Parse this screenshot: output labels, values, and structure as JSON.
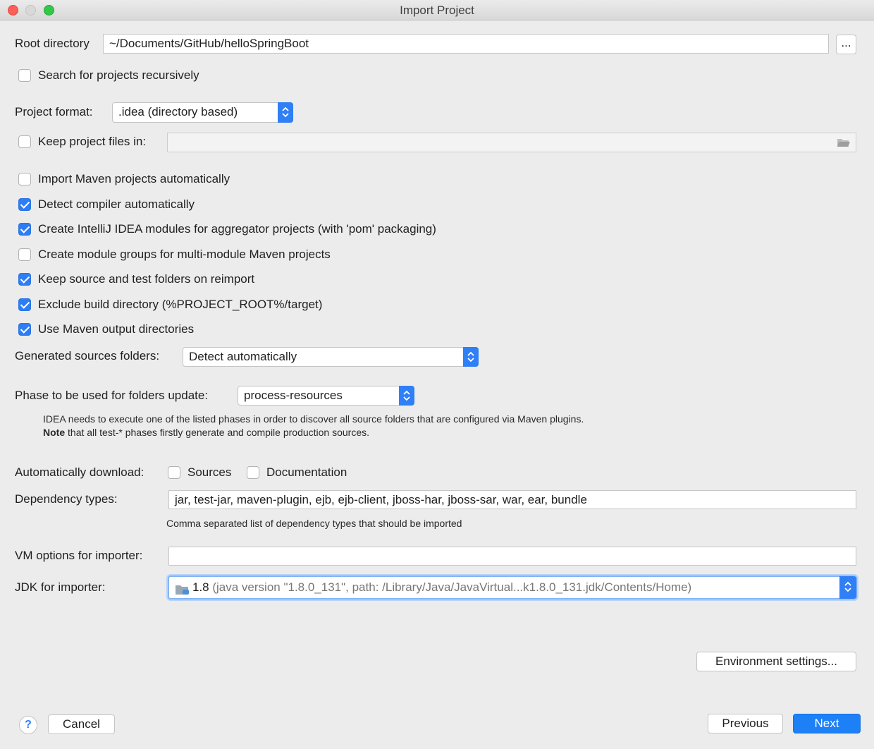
{
  "window": {
    "title": "Import Project"
  },
  "root_directory": {
    "label": "Root directory",
    "value": "~/Documents/GitHub/helloSpringBoot",
    "browse_label": "..."
  },
  "search_recursive": {
    "label": "Search for projects recursively",
    "checked": false
  },
  "project_format": {
    "label": "Project format:",
    "value": ".idea (directory based)"
  },
  "keep_files": {
    "label": "Keep project files in:",
    "value": "",
    "checked": false
  },
  "options": [
    {
      "label": "Import Maven projects automatically",
      "checked": false
    },
    {
      "label": "Detect compiler automatically",
      "checked": true
    },
    {
      "label": "Create IntelliJ IDEA modules for aggregator projects (with 'pom' packaging)",
      "checked": true
    },
    {
      "label": "Create module groups for multi-module Maven projects",
      "checked": false
    },
    {
      "label": "Keep source and test folders on reimport",
      "checked": true
    },
    {
      "label": "Exclude build directory (%PROJECT_ROOT%/target)",
      "checked": true
    },
    {
      "label": "Use Maven output directories",
      "checked": true
    }
  ],
  "generated_sources": {
    "label": "Generated sources folders:",
    "value": "Detect automatically"
  },
  "phase": {
    "label": "Phase to be used for folders update:",
    "value": "process-resources",
    "note_line1": "IDEA needs to execute one of the listed phases in order to discover all source folders that are configured via Maven plugins.",
    "note_bold": "Note",
    "note_line2": " that all test-* phases firstly generate and compile production sources."
  },
  "auto_download": {
    "label": "Automatically download:",
    "sources": {
      "label": "Sources",
      "checked": false
    },
    "documentation": {
      "label": "Documentation",
      "checked": false
    }
  },
  "dependency_types": {
    "label": "Dependency types:",
    "value": "jar, test-jar, maven-plugin, ejb, ejb-client, jboss-har, jboss-sar, war, ear, bundle",
    "hint": "Comma separated list of dependency types that should be imported"
  },
  "vm_options": {
    "label": "VM options for importer:",
    "value": ""
  },
  "jdk": {
    "label": "JDK for importer:",
    "version": "1.8",
    "detail": " (java version \"1.8.0_131\", path: /Library/Java/JavaVirtual...k1.8.0_131.jdk/Contents/Home)"
  },
  "buttons": {
    "environment": "Environment settings...",
    "help": "?",
    "cancel": "Cancel",
    "previous": "Previous",
    "next": "Next"
  },
  "colors": {
    "accent": "#2f7ff6",
    "primary_button": "#1d80f6",
    "background": "#ececec"
  },
  "icons": {
    "folder": "folder-icon",
    "jdk": "jdk-folder-icon",
    "stepper": "up-down-chevron-icon"
  }
}
